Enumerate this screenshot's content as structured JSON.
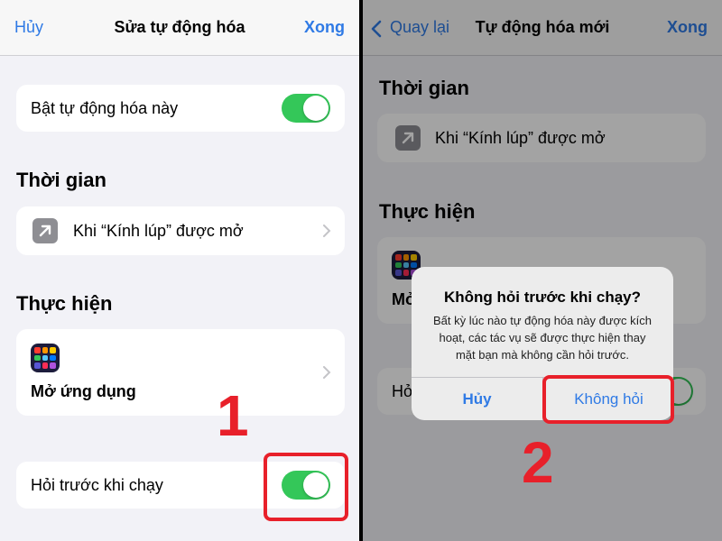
{
  "left": {
    "nav": {
      "cancel": "Hủy",
      "title": "Sửa tự động hóa",
      "done": "Xong"
    },
    "enable_label": "Bật tự động hóa này",
    "enable_on": true,
    "section_when": "Thời gian",
    "trigger_label": "Khi “Kính lúp” được mở",
    "section_do": "Thực hiện",
    "action_label": "Mở ứng dụng",
    "ask_label": "Hỏi trước khi chạy",
    "ask_on": true,
    "step": "1"
  },
  "right": {
    "nav": {
      "back": "Quay lại",
      "title": "Tự động hóa mới",
      "done": "Xong"
    },
    "section_when": "Thời gian",
    "trigger_label": "Khi “Kính lúp” được mở",
    "section_do": "Thực hiện",
    "action_partial": "Mở",
    "ask_partial": "Hỏ",
    "alert": {
      "title": "Không hỏi trước khi chạy?",
      "message": "Bất kỳ lúc nào tự động hóa này được kích hoạt, các tác vụ sẽ được thực hiện thay mặt bạn mà không cần hỏi trước.",
      "cancel": "Hủy",
      "confirm": "Không hỏi"
    },
    "step": "2"
  },
  "colors": {
    "accent": "#2f7ae5",
    "toggle_on": "#34c759",
    "highlight": "#e8202a",
    "app_tiles": [
      "#ff3b30",
      "#ff9500",
      "#ffcc00",
      "#34c759",
      "#5ac8fa",
      "#007aff",
      "#5856d6",
      "#ff2d55",
      "#af52de"
    ]
  },
  "icons": {
    "trigger": "arrow-up-right-icon",
    "action": "app-grid-icon",
    "disclosure": "chevron-right-icon",
    "back": "chevron-left-icon"
  }
}
